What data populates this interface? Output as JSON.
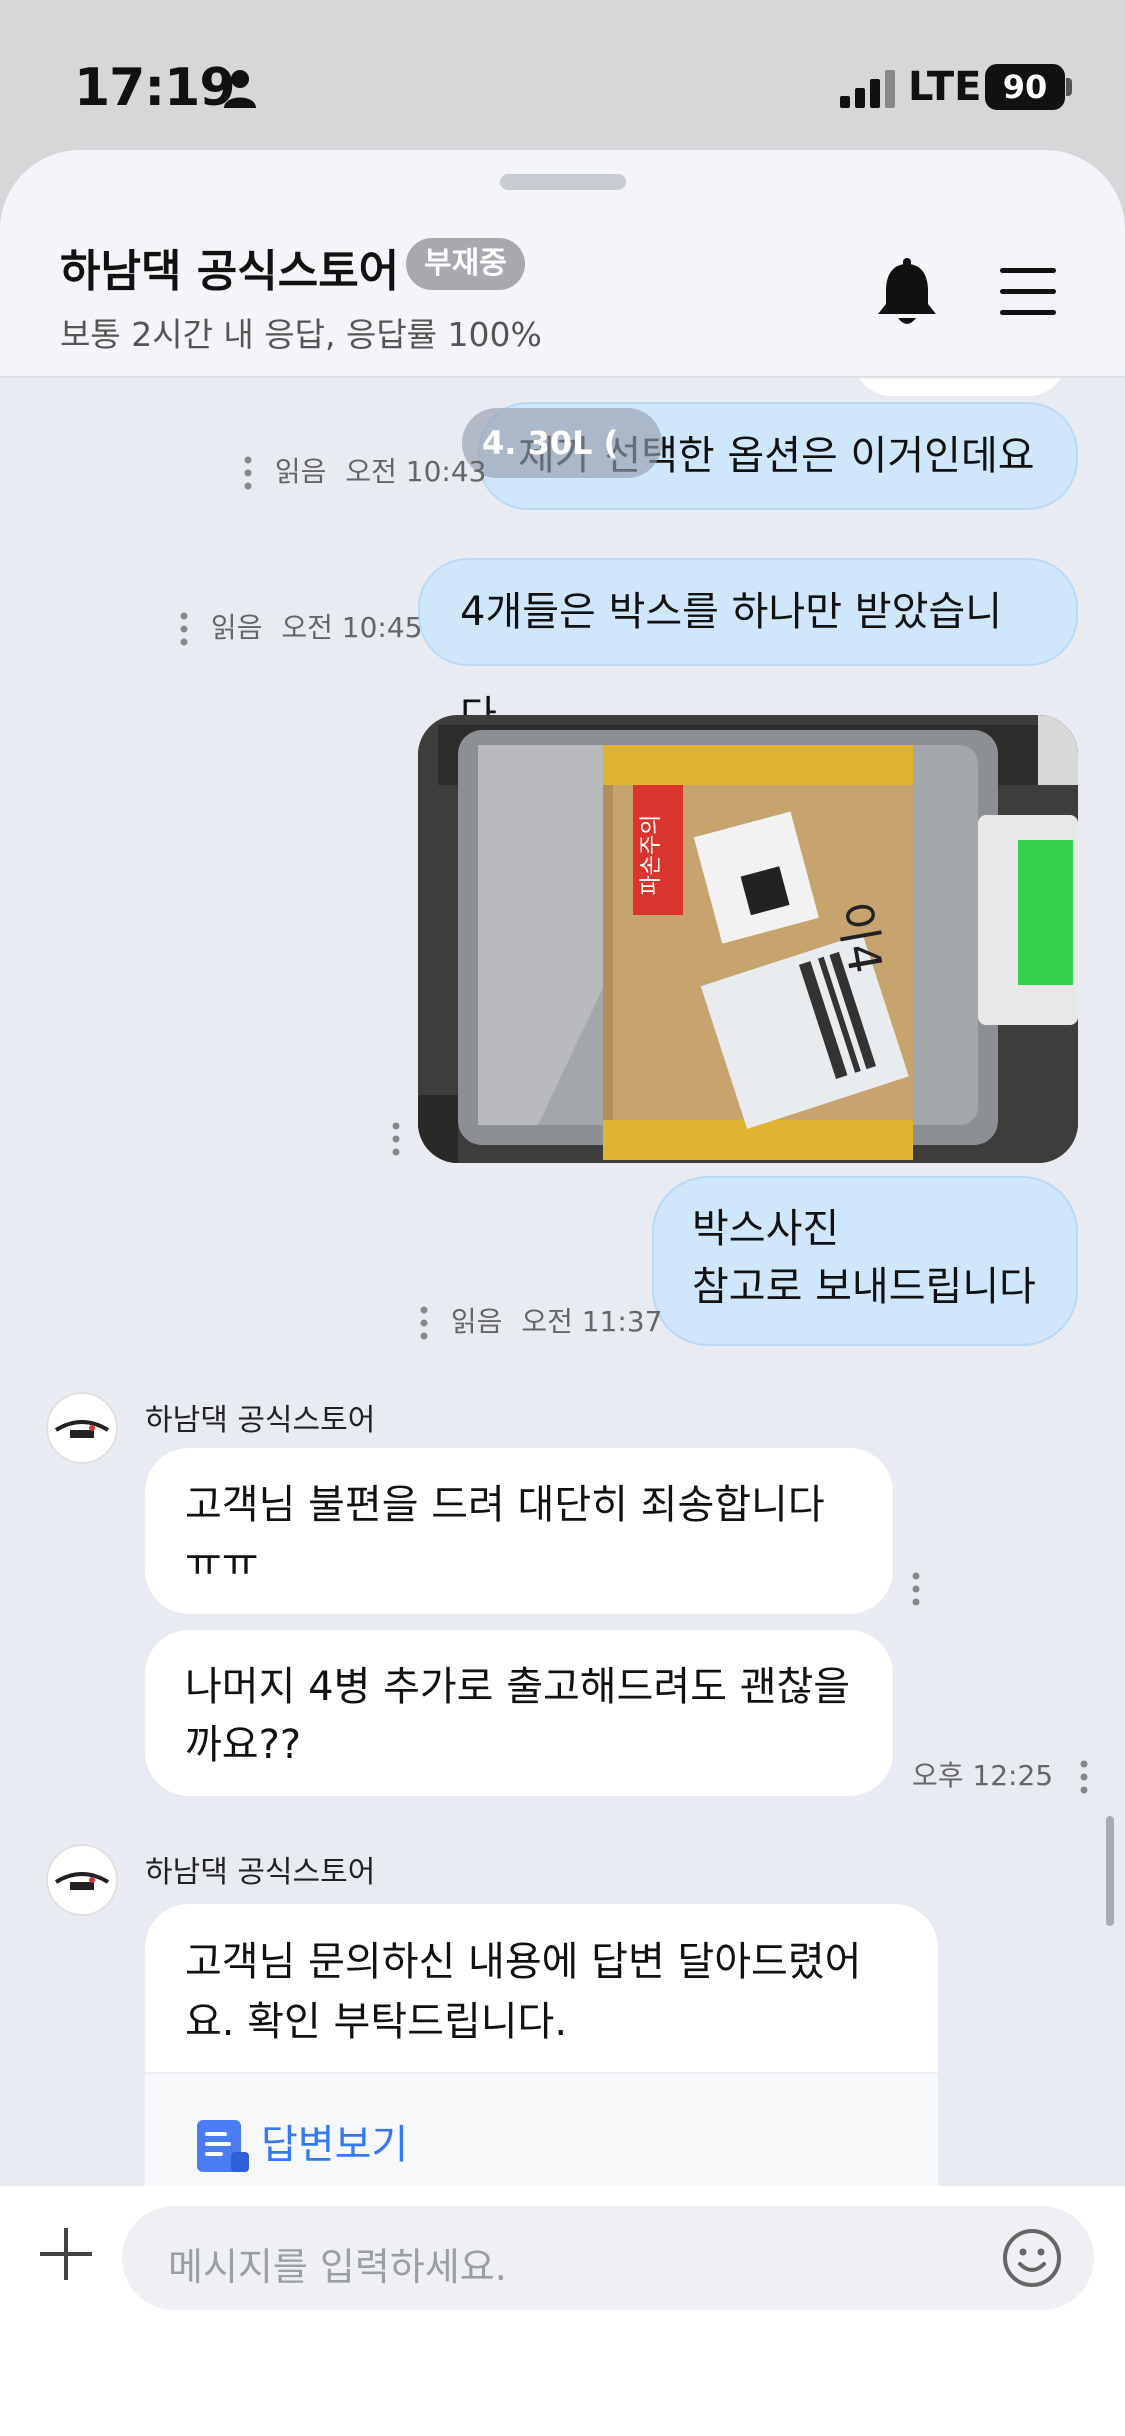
{
  "status": {
    "time": "17:19",
    "network": "LTE",
    "battery": "90"
  },
  "header": {
    "title": "하남댁 공식스토어",
    "badge": "부재중",
    "subtitle": "보통 2시간 내 응답, 응답률 100%",
    "icons": [
      "bell-icon",
      "menu-icon"
    ]
  },
  "messages": {
    "m1": {
      "text": "제가 선택한 옵션은 이거인데요",
      "overlay": "4. 30L (",
      "read": "읽음",
      "time": "오전 10:43"
    },
    "m2": {
      "text": "4개들은 박스를 하나만 받았습니다",
      "read": "읽음",
      "time": "오전 10:45"
    },
    "photo": {
      "label_red": "파손주의",
      "handwriting": "이4"
    },
    "m3": {
      "line1": "박스사진",
      "line2": "참고로 보내드립니다",
      "read": "읽음",
      "time": "오전 11:37"
    },
    "in1": {
      "sender": "하남댁 공식스토어",
      "b1": "고객님 불편을 드려 대단히 죄송합니다 ㅠㅠ",
      "b2": "나머지 4병 추가로 출고해드려도 괜찮을까요??",
      "time": "오후 12:25"
    },
    "in2": {
      "sender": "하남댁 공식스토어",
      "text": "고객님 문의하신 내용에 답변 달아드렸어요. 확인 부탁드립니다.",
      "button": "답변보기"
    }
  },
  "input": {
    "placeholder": "메시지를 입력하세요."
  },
  "colors": {
    "outgoing": "#cfe6fb",
    "link": "#3478f6",
    "badge": "#a7a9ae"
  }
}
